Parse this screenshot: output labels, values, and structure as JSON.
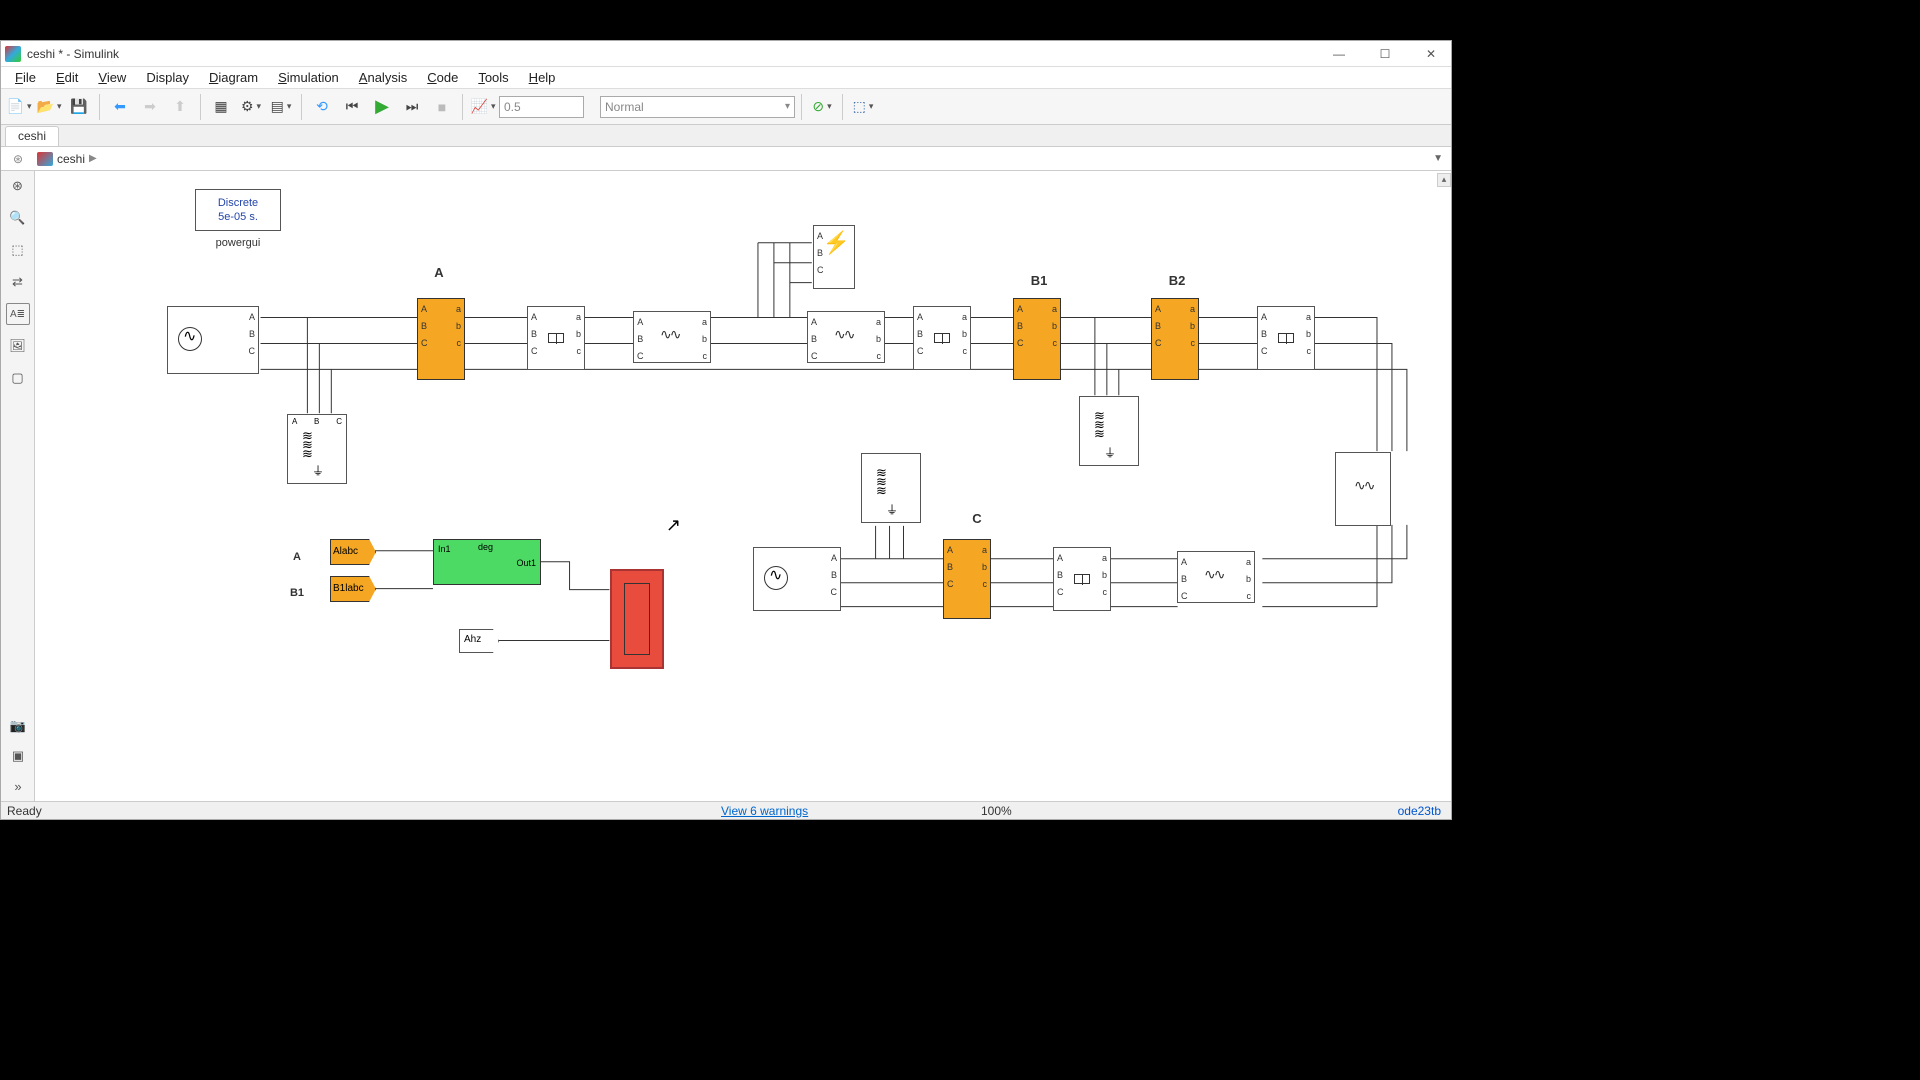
{
  "window": {
    "title": "ceshi * - Simulink"
  },
  "menu": {
    "file": "File",
    "edit": "Edit",
    "view": "View",
    "display": "Display",
    "diagram": "Diagram",
    "simulation": "Simulation",
    "analysis": "Analysis",
    "code": "Code",
    "tools": "Tools",
    "help": "Help"
  },
  "toolbar": {
    "stop_time": "0.5",
    "sim_mode": "Normal"
  },
  "tabs": {
    "main": "ceshi"
  },
  "breadcrumb": {
    "root": "ceshi"
  },
  "canvas": {
    "powergui": {
      "line1": "Discrete",
      "line2": "5e-05 s.",
      "label": "powergui"
    },
    "labels": {
      "A": "A",
      "B1": "B1",
      "B2": "B2",
      "C": "C",
      "tagA": "A",
      "tagB1": "B1"
    },
    "tags": {
      "alabc": "Alabc",
      "b1labc": "B1labc",
      "ahz": "Ahz"
    },
    "subsys": {
      "in1": "In1",
      "deg": "deg",
      "out1": "Out1"
    },
    "ports": {
      "A": "A",
      "B": "B",
      "C": "C",
      "a": "a",
      "b": "b",
      "c": "c"
    }
  },
  "status": {
    "ready": "Ready",
    "warnings": "View 6 warnings",
    "zoom": "100%",
    "solver": "ode23tb"
  }
}
